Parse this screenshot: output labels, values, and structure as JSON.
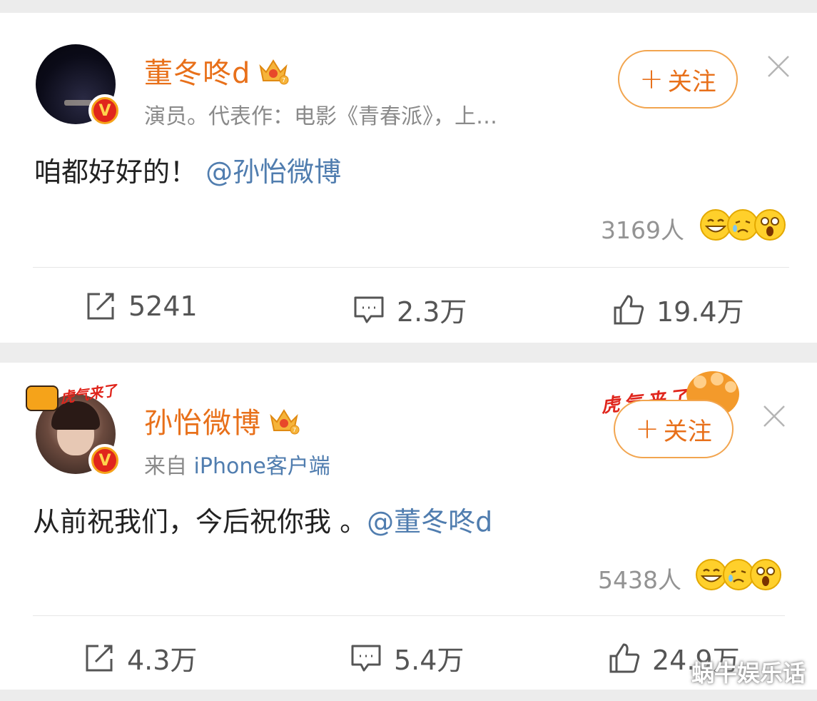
{
  "posts": [
    {
      "author": "董冬咚d",
      "meta": "演员。代表作：电影《青春派》，上…",
      "follow_label": "关注",
      "content_text": "咱都好好的！",
      "content_mention": "@孙怡微博",
      "reaction_count": "3169人",
      "repost": "5241",
      "comment": "2.3万",
      "like": "19.4万"
    },
    {
      "author": "孙怡微博",
      "meta_prefix": "来自",
      "meta_source": "iPhone客户端",
      "avatar_badge": "虎气来了",
      "follow_badge": "虎气来了",
      "follow_label": "关注",
      "content_text": "从前祝我们，今后祝你我 。",
      "content_mention": "@董冬咚d",
      "reaction_count": "5438人",
      "repost": "4.3万",
      "comment": "5.4万",
      "like": "24.9万"
    }
  ],
  "watermark": "蜗牛娱乐话",
  "colors": {
    "author": "#e8701a",
    "mention": "#507daf",
    "gray_text": "#8a8a8a"
  },
  "icons": {
    "repost": "repost-icon",
    "comment": "comment-icon",
    "like": "like-icon",
    "close": "close-icon",
    "crown": "crown-badge-icon",
    "verified": "verified-v-icon"
  }
}
